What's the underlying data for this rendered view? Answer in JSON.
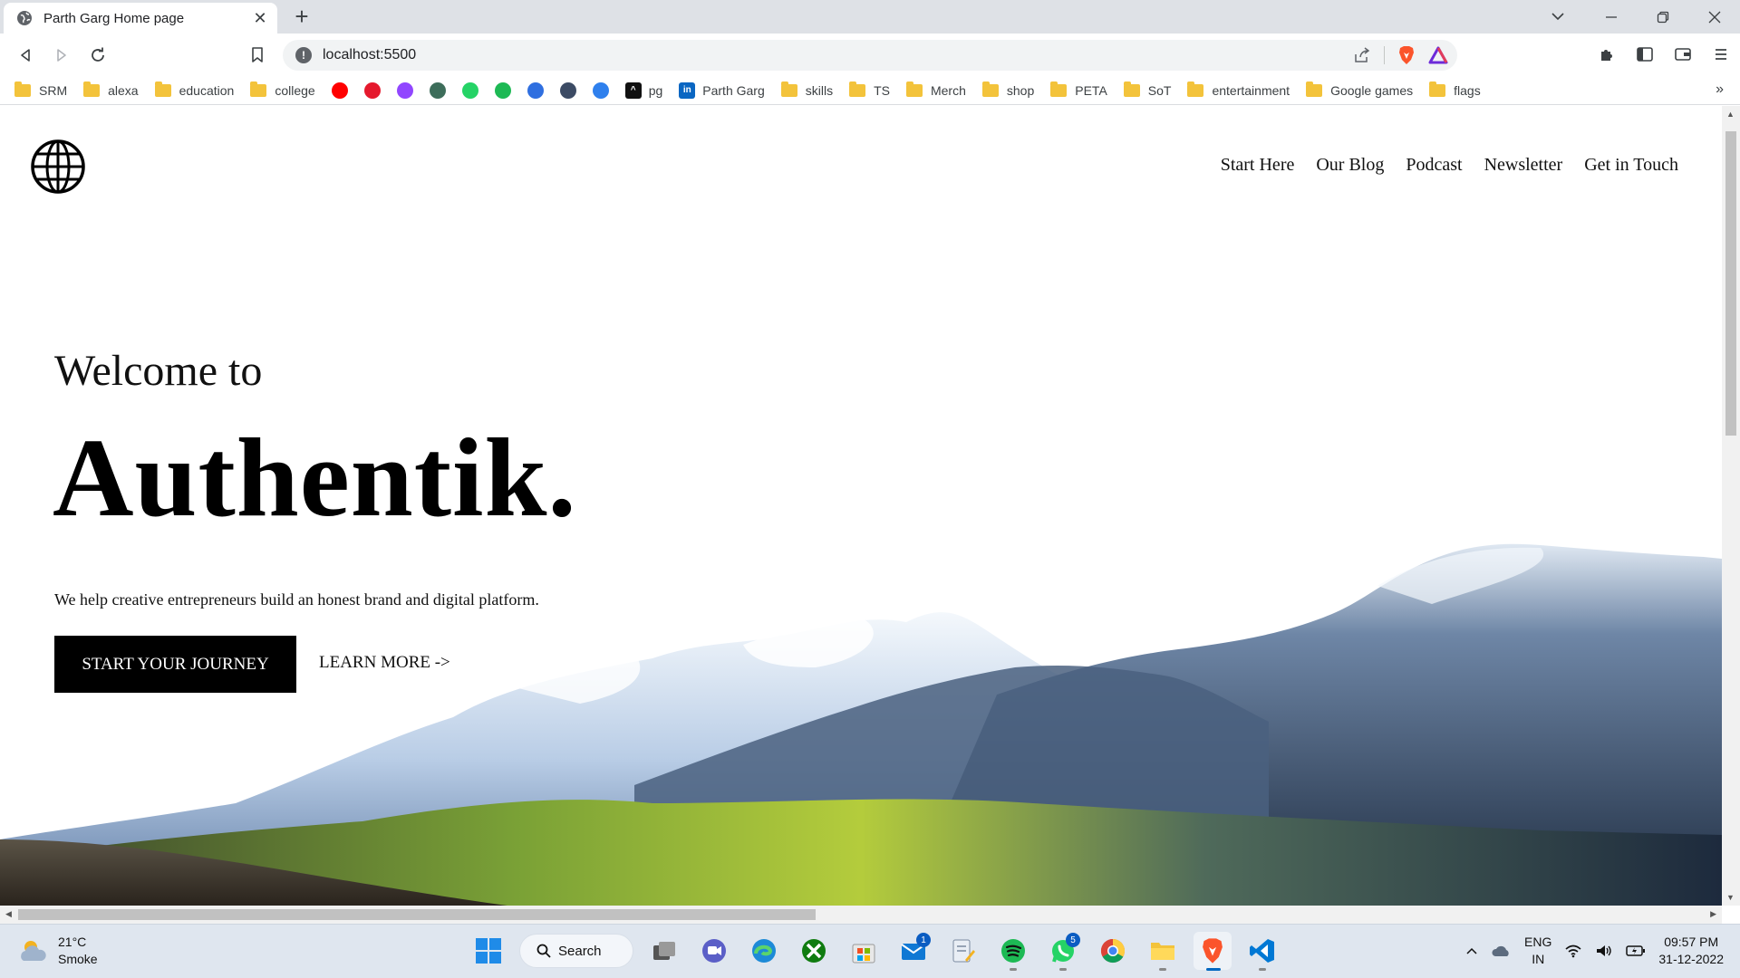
{
  "browser": {
    "tab_title": "Parth Garg Home page",
    "address": "localhost:5500",
    "bookmarks": [
      {
        "type": "folder",
        "label": "SRM"
      },
      {
        "type": "folder",
        "label": "alexa"
      },
      {
        "type": "folder",
        "label": "education"
      },
      {
        "type": "folder",
        "label": "college"
      },
      {
        "type": "icon",
        "label": "",
        "icon": "youtube-icon",
        "color": "#ff0000"
      },
      {
        "type": "icon",
        "label": "",
        "icon": "music-icon",
        "color": "#e5192d"
      },
      {
        "type": "icon",
        "label": "",
        "icon": "twitch-icon",
        "color": "#9146ff"
      },
      {
        "type": "icon",
        "label": "",
        "icon": "image-icon",
        "color": "#3d6d5a"
      },
      {
        "type": "icon",
        "label": "",
        "icon": "whatsapp-icon",
        "color": "#25d366"
      },
      {
        "type": "icon",
        "label": "",
        "icon": "spotify-icon",
        "color": "#1db954"
      },
      {
        "type": "icon",
        "label": "",
        "icon": "podcast-icon",
        "color": "#2f6fe0"
      },
      {
        "type": "icon",
        "label": "",
        "icon": "plus-icon",
        "color": "#3c4b64"
      },
      {
        "type": "icon",
        "label": "",
        "icon": "canva-icon",
        "color": "#2f80ed"
      },
      {
        "type": "icon",
        "label": "pg",
        "icon": "pg-icon",
        "color": "#111111"
      },
      {
        "type": "icon",
        "label": "Parth Garg",
        "icon": "linkedin-icon",
        "color": "#0a66c2"
      },
      {
        "type": "folder",
        "label": "skills"
      },
      {
        "type": "folder",
        "label": "TS"
      },
      {
        "type": "folder",
        "label": "Merch"
      },
      {
        "type": "folder",
        "label": "shop"
      },
      {
        "type": "folder",
        "label": "PETA"
      },
      {
        "type": "folder",
        "label": "SoT"
      },
      {
        "type": "folder",
        "label": "entertainment"
      },
      {
        "type": "folder",
        "label": "Google games"
      },
      {
        "type": "folder",
        "label": "flags"
      }
    ],
    "bookmarks_more": "»"
  },
  "site": {
    "nav": [
      "Start Here",
      "Our Blog",
      "Podcast",
      "Newsletter",
      "Get in Touch"
    ],
    "welcome": "Welcome to",
    "title": "Authentik.",
    "subtitle": "We help creative entrepreneurs build an honest brand and digital platform.",
    "cta_primary": "START YOUR JOURNEY",
    "cta_secondary": "LEARN MORE ->"
  },
  "taskbar": {
    "weather_temp": "21°C",
    "weather_desc": "Smoke",
    "search_label": "Search",
    "lang_primary": "ENG",
    "lang_region": "IN",
    "time": "09:57 PM",
    "date": "31-12-2022",
    "teams_badge": "1",
    "whatsapp_badge": "5"
  },
  "colors": {
    "accent": "#0067c0",
    "brave": "#fb542b"
  }
}
